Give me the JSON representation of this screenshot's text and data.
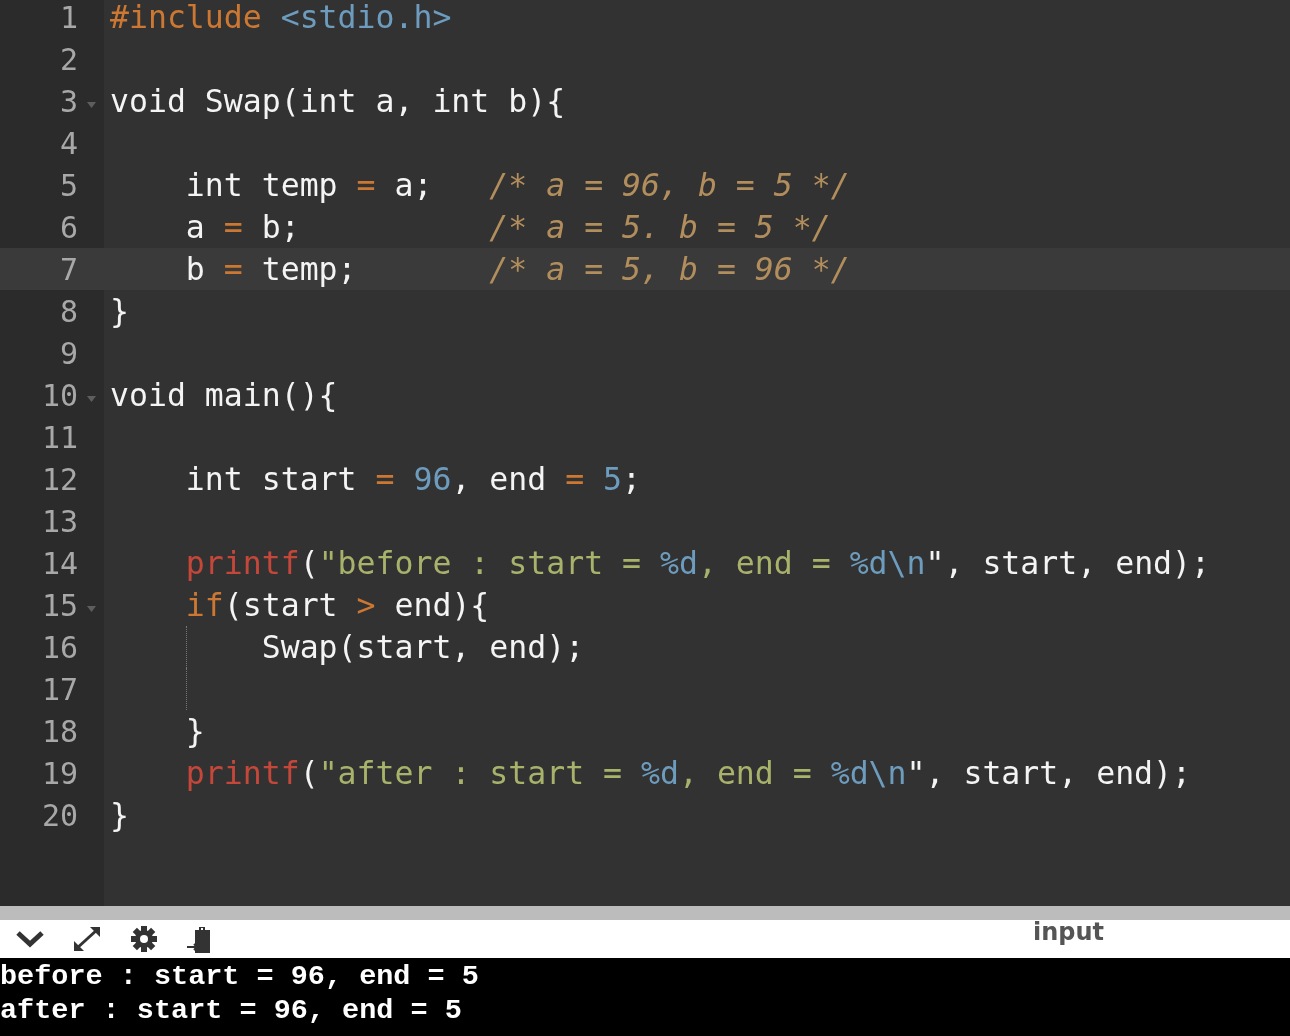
{
  "editor": {
    "lines": [
      {
        "number": "1",
        "foldable": false,
        "active": false,
        "guide": false,
        "tokens": [
          {
            "kind": "include",
            "text": "#include "
          },
          {
            "kind": "header",
            "text": "<stdio.h>"
          }
        ]
      },
      {
        "number": "2",
        "foldable": false,
        "active": false,
        "guide": false
      },
      {
        "number": "3",
        "foldable": true,
        "active": false,
        "guide": false,
        "tokens": [
          {
            "kind": "plain",
            "text": "void Swap(int a, int b){"
          }
        ]
      },
      {
        "number": "4",
        "foldable": false,
        "active": false,
        "guide": false
      },
      {
        "number": "5",
        "foldable": false,
        "active": false,
        "guide": false,
        "tokens": [
          {
            "kind": "plain",
            "text": "    int temp "
          },
          {
            "kind": "operator",
            "text": "="
          },
          {
            "kind": "plain",
            "text": " a;   "
          },
          {
            "kind": "comment",
            "text": "/* a = 96, b = 5 */"
          }
        ]
      },
      {
        "number": "6",
        "foldable": false,
        "active": false,
        "guide": false,
        "tokens": [
          {
            "kind": "plain",
            "text": "    a "
          },
          {
            "kind": "operator",
            "text": "="
          },
          {
            "kind": "plain",
            "text": " b;          "
          },
          {
            "kind": "comment",
            "text": "/* a = 5. b = 5 */"
          }
        ]
      },
      {
        "number": "7",
        "foldable": false,
        "active": true,
        "guide": false,
        "tokens": [
          {
            "kind": "plain",
            "text": "    b "
          },
          {
            "kind": "operator",
            "text": "="
          },
          {
            "kind": "plain",
            "text": " temp;       "
          },
          {
            "kind": "comment",
            "text": "/* a = 5, b = 96 */"
          }
        ]
      },
      {
        "number": "8",
        "foldable": false,
        "active": false,
        "guide": false,
        "tokens": [
          {
            "kind": "plain",
            "text": "}"
          }
        ]
      },
      {
        "number": "9",
        "foldable": false,
        "active": false,
        "guide": false
      },
      {
        "number": "10",
        "foldable": true,
        "active": false,
        "guide": false,
        "tokens": [
          {
            "kind": "plain",
            "text": "void main(){"
          }
        ]
      },
      {
        "number": "11",
        "foldable": false,
        "active": false,
        "guide": false
      },
      {
        "number": "12",
        "foldable": false,
        "active": false,
        "guide": false,
        "tokens": [
          {
            "kind": "plain",
            "text": "    int start "
          },
          {
            "kind": "operator",
            "text": "="
          },
          {
            "kind": "number",
            "text": " 96"
          },
          {
            "kind": "plain",
            "text": ", end "
          },
          {
            "kind": "operator",
            "text": "="
          },
          {
            "kind": "number",
            "text": " 5"
          },
          {
            "kind": "plain",
            "text": ";"
          }
        ]
      },
      {
        "number": "13",
        "foldable": false,
        "active": false,
        "guide": false
      },
      {
        "number": "14",
        "foldable": false,
        "active": false,
        "guide": false,
        "tokens": [
          {
            "kind": "function",
            "text": "    printf"
          },
          {
            "kind": "plain",
            "text": "("
          },
          {
            "kind": "string",
            "text": "\"before : start = "
          },
          {
            "kind": "escape",
            "text": "%d"
          },
          {
            "kind": "string",
            "text": ", end = "
          },
          {
            "kind": "escape",
            "text": "%d\\n"
          },
          {
            "kind": "plain",
            "text": "\", start, end);"
          }
        ]
      },
      {
        "number": "15",
        "foldable": true,
        "active": false,
        "guide": false,
        "tokens": [
          {
            "kind": "keyword",
            "text": "    if"
          },
          {
            "kind": "plain",
            "text": "(start "
          },
          {
            "kind": "operator",
            "text": ">"
          },
          {
            "kind": "plain",
            "text": " end){"
          }
        ]
      },
      {
        "number": "16",
        "foldable": false,
        "active": false,
        "guide": true,
        "tokens": [
          {
            "kind": "plain",
            "text": "        Swap(start, end);"
          }
        ]
      },
      {
        "number": "17",
        "foldable": false,
        "active": false,
        "guide": true
      },
      {
        "number": "18",
        "foldable": false,
        "active": false,
        "guide": false,
        "tokens": [
          {
            "kind": "plain",
            "text": "    }"
          }
        ]
      },
      {
        "number": "19",
        "foldable": false,
        "active": false,
        "guide": false,
        "tokens": [
          {
            "kind": "function",
            "text": "    printf"
          },
          {
            "kind": "plain",
            "text": "("
          },
          {
            "kind": "string",
            "text": "\"after : start = "
          },
          {
            "kind": "escape",
            "text": "%d"
          },
          {
            "kind": "string",
            "text": ", end = "
          },
          {
            "kind": "escape",
            "text": "%d\\n"
          },
          {
            "kind": "plain",
            "text": "\", start, end);"
          }
        ]
      },
      {
        "number": "20",
        "foldable": false,
        "active": false,
        "guide": false,
        "tokens": [
          {
            "kind": "plain",
            "text": "}"
          }
        ]
      }
    ]
  },
  "toolbar": {
    "input_label": "input"
  },
  "output": {
    "lines": [
      "before : start = 96, end = 5",
      "after : start = 96, end = 5"
    ]
  }
}
